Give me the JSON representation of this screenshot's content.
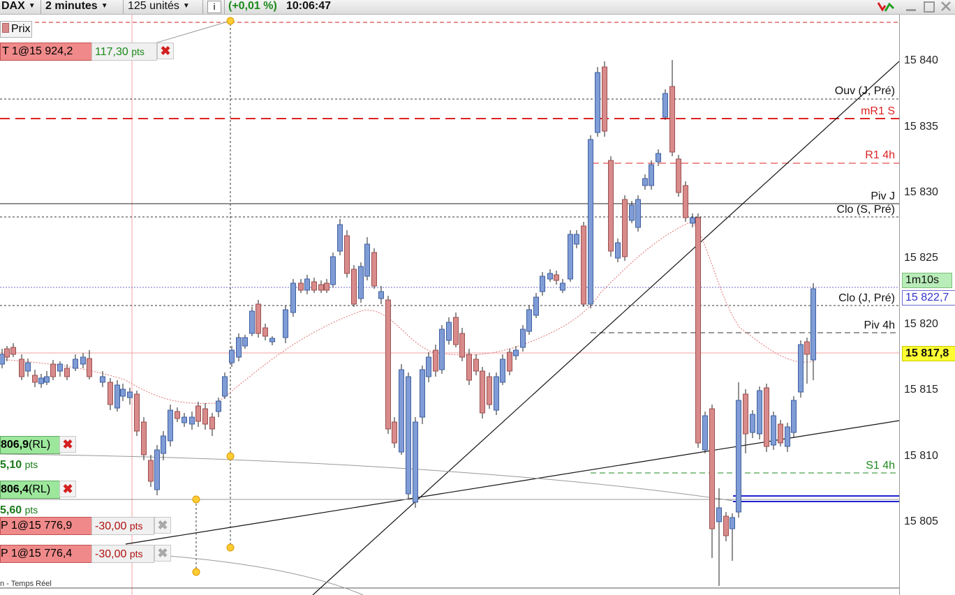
{
  "toolbar": {
    "instrument": "DAX",
    "timeframe": "2 minutes",
    "units": "125 unités",
    "info_icon": "info-icon",
    "change": "(+0,01 %)",
    "time": "10:06:47"
  },
  "legend": {
    "label": "Prix"
  },
  "position": {
    "label": "T 1@15 924,2",
    "pnl": "117,30",
    "pnl_unit": "pts"
  },
  "orders": [
    {
      "label": "806,9",
      "tag": "(RL)",
      "pts": "5,10",
      "pts_unit": "pts"
    },
    {
      "label": "806,4",
      "tag": "(RL)",
      "pts": "5,60",
      "pts_unit": "pts"
    },
    {
      "label": "P 1@15 776,9",
      "value": "-30,00",
      "unit": "pts"
    },
    {
      "label": "P 1@15 776,4",
      "value": "-30,00",
      "unit": "pts"
    }
  ],
  "footer": {
    "text": "n - Temps Réel"
  },
  "levels": {
    "ouv_j_pre": "Ouv (J, Pré)",
    "mr1_s": "mR1 S",
    "r1_4h": "R1 4h",
    "piv_j": "Piv J",
    "clo_s_pre": "Clo (S, Pré)",
    "clo_j_pre": "Clo (J, Pré)",
    "piv_4h": "Piv 4h",
    "s1_4h": "S1 4h"
  },
  "axis": {
    "ticks": [
      "15 840",
      "15 835",
      "15 830",
      "15 825",
      "15 820",
      "15 815",
      "15 810",
      "15 805"
    ],
    "countdown": "1m10s",
    "price_blue": "15 822,7",
    "price_yellow": "15 817,8"
  },
  "colors": {
    "bull_candle": "#7f9cd6",
    "bear_candle": "#d98b8b",
    "resistance": "#dd2222",
    "support": "#1e8a1e",
    "countdown_bg": "#b8ecb8",
    "last_price_bg": "#ffff33"
  }
}
